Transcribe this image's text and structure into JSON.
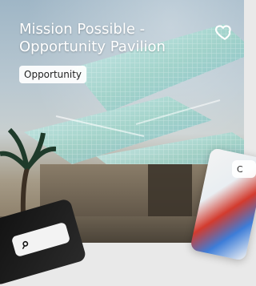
{
  "card": {
    "title": "Mission Possible - Opportunity Pavilion",
    "badge": "Opportunity",
    "favorite_icon": "heart-outline-icon"
  },
  "peek_cards": {
    "right_label": "C",
    "bottom_left_icon": "search-icon"
  }
}
